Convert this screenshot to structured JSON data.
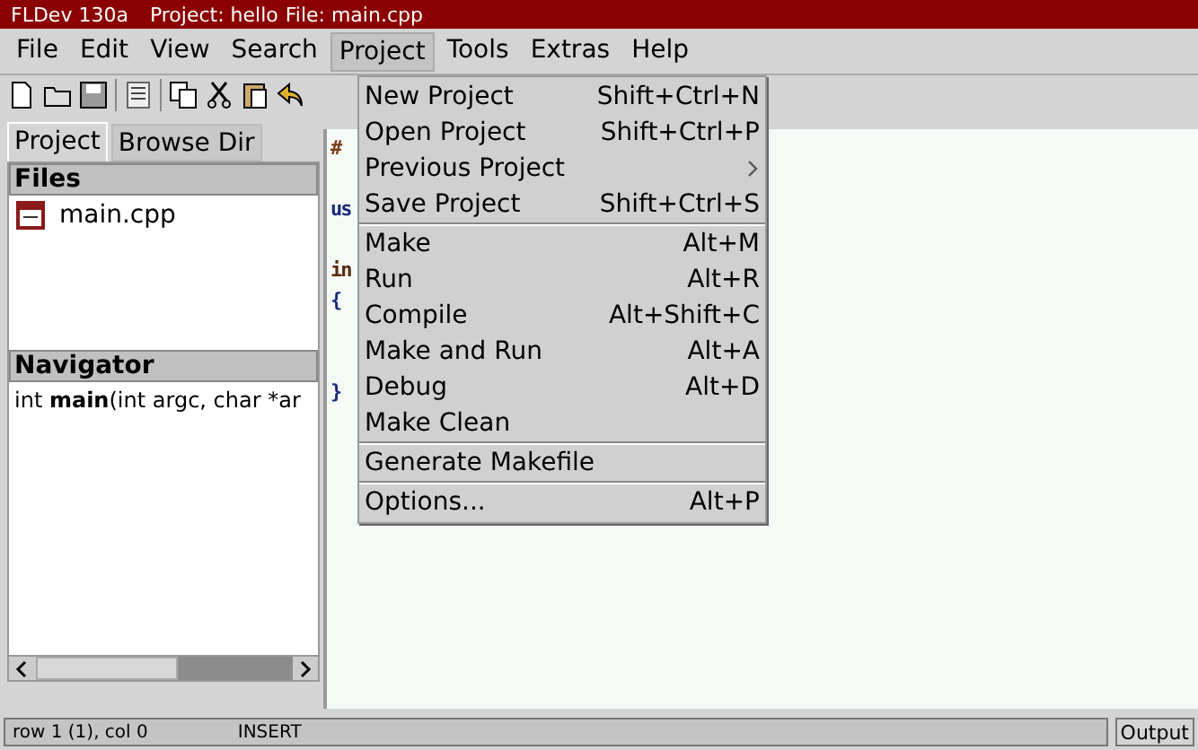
{
  "window": {
    "title": "FLDev 130a",
    "project": "Project: hello",
    "file": "File: main.cpp"
  },
  "menu_bar": [
    {
      "label": "File",
      "selected": false
    },
    {
      "label": "Edit",
      "selected": false
    },
    {
      "label": "View",
      "selected": false
    },
    {
      "label": "Search",
      "selected": false
    },
    {
      "label": "Project",
      "selected": true
    },
    {
      "label": "Tools",
      "selected": false
    },
    {
      "label": "Extras",
      "selected": false
    },
    {
      "label": "Help",
      "selected": false
    }
  ],
  "left_tabs": [
    {
      "label": "Project",
      "selected": true
    },
    {
      "label": "Browse Dir",
      "selected": false
    }
  ],
  "files": {
    "title": "Files",
    "items": [
      "main.cpp"
    ]
  },
  "navigator": {
    "title": "Navigator",
    "items": [
      "int **main**(int argc, char *ar"
    ]
  },
  "editor": {
    "lines": [
      {
        "kind": "code",
        "text": "#",
        "color": "#7a3a1a"
      },
      {
        "kind": "blank"
      },
      {
        "kind": "code",
        "text": "us",
        "color": "#1a2a7a"
      },
      {
        "kind": "blank"
      },
      {
        "kind": "code",
        "text": "in",
        "color": "#5a2a0a"
      },
      {
        "kind": "code",
        "text": "{",
        "color": "#1a2a7a"
      },
      {
        "kind": "blank"
      },
      {
        "kind": "blank"
      },
      {
        "kind": "code",
        "text": "}",
        "color": "#1a2a7a"
      }
    ]
  },
  "project_menu": [
    {
      "kind": "item",
      "label": "New Project",
      "shortcut": "Shift+Ctrl+N"
    },
    {
      "kind": "item",
      "label": "Open Project",
      "shortcut": "Shift+Ctrl+P"
    },
    {
      "kind": "submenu",
      "label": "Previous Project"
    },
    {
      "kind": "item",
      "label": "Save Project",
      "shortcut": "Shift+Ctrl+S"
    },
    {
      "kind": "separator"
    },
    {
      "kind": "item",
      "label": "Make",
      "shortcut": "Alt+M"
    },
    {
      "kind": "item",
      "label": "Run",
      "shortcut": "Alt+R"
    },
    {
      "kind": "item",
      "label": "Compile",
      "shortcut": "Alt+Shift+C"
    },
    {
      "kind": "item",
      "label": "Make and Run",
      "shortcut": "Alt+A"
    },
    {
      "kind": "item",
      "label": "Debug",
      "shortcut": "Alt+D"
    },
    {
      "kind": "item",
      "label": "Make Clean"
    },
    {
      "kind": "separator"
    },
    {
      "kind": "item",
      "label": "Generate Makefile"
    },
    {
      "kind": "separator"
    },
    {
      "kind": "item",
      "label": "Options...",
      "shortcut": "Alt+P"
    }
  ],
  "status_bar": {
    "position": "row 1 (1), col 0",
    "mode": "INSERT",
    "output_button": "Output"
  }
}
